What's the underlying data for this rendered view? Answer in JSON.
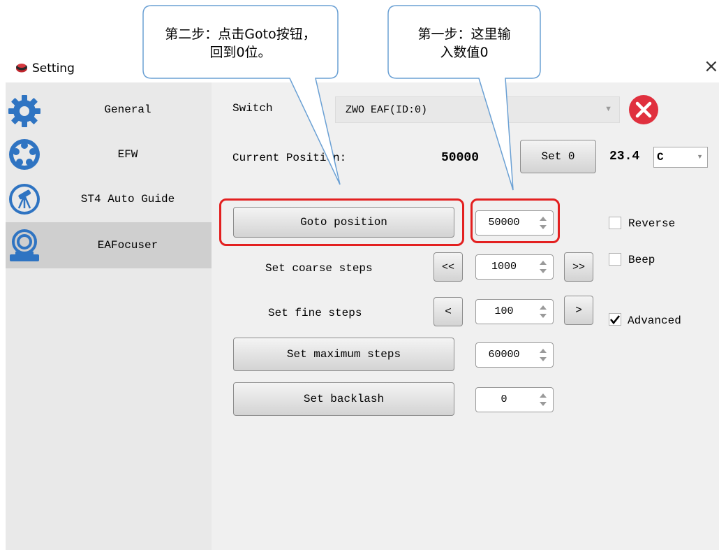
{
  "window": {
    "title": "Setting",
    "close_glyph": "×"
  },
  "sidebar": {
    "items": [
      {
        "label": "General",
        "icon": "gear-icon"
      },
      {
        "label": "EFW",
        "icon": "filter-wheel-icon"
      },
      {
        "label": "ST4 Auto Guide",
        "icon": "telescope-icon"
      },
      {
        "label": "EAFocuser",
        "icon": "focuser-icon",
        "active": true
      }
    ]
  },
  "main": {
    "switch_label": "Switch",
    "device_select": "ZWO EAF(ID:0)",
    "current_position_label": "Current Position:",
    "current_position_value": "50000",
    "set0_label": "Set 0",
    "temperature_value": "23.4",
    "temperature_unit": "C",
    "goto_button": "Goto position",
    "goto_value": "50000",
    "coarse_label": "Set coarse steps",
    "coarse_dec": "<<",
    "coarse_value": "1000",
    "coarse_inc": ">>",
    "fine_label": "Set fine steps",
    "fine_dec": "<",
    "fine_value": "100",
    "fine_inc": ">",
    "max_button": "Set maximum steps",
    "max_value": "60000",
    "backlash_button": "Set backlash",
    "backlash_value": "0",
    "reverse_label": "Reverse",
    "reverse_checked": false,
    "beep_label": "Beep",
    "beep_checked": false,
    "advanced_label": "Advanced",
    "advanced_checked": true
  },
  "annotations": {
    "step2_line1": "第二步：点击Goto按钮，",
    "step2_line2": "回到0位。",
    "step1_line1": "第一步：这里输",
    "step1_line2": "入数值0"
  },
  "colors": {
    "highlight": "#e32020",
    "callout_border": "#6aa0d4",
    "close_red": "#e0303e",
    "icon_blue": "#2f74c2",
    "sidebar_active": "#cfcfcf"
  }
}
